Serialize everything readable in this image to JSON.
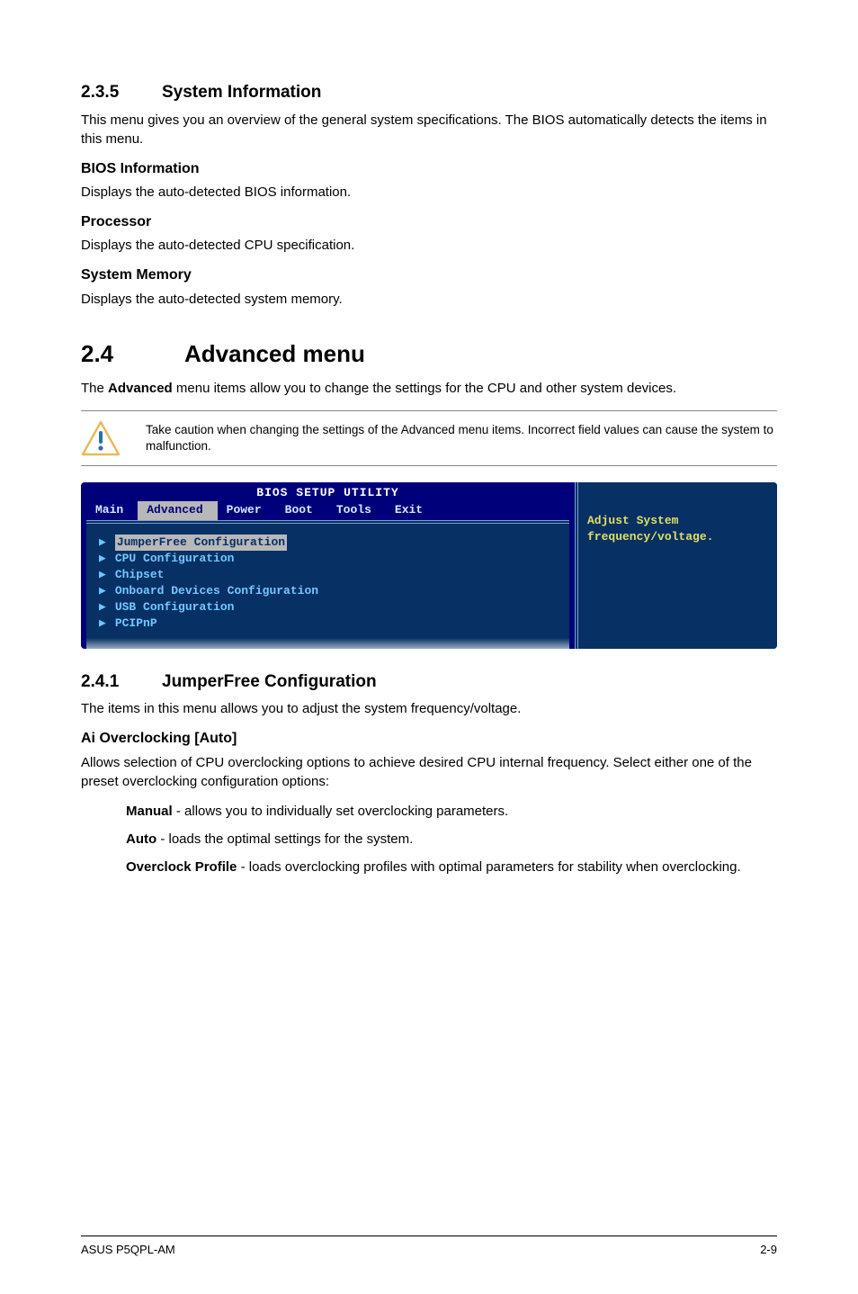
{
  "sec235": {
    "heading_num": "2.3.5",
    "heading_text": "System Information",
    "intro": "This menu gives you an overview of the general system specifications. The BIOS automatically detects the items in this menu.",
    "bios_info_h": "BIOS Information",
    "bios_info_p": "Displays the auto-detected BIOS information.",
    "proc_h": "Processor",
    "proc_p": "Displays the auto-detected CPU specification.",
    "mem_h": "System Memory",
    "mem_p": "Displays the auto-detected system memory."
  },
  "sec24": {
    "heading_num": "2.4",
    "heading_text": "Advanced menu",
    "intro_pre": "The ",
    "intro_bold": "Advanced",
    "intro_post": " menu items allow you to change the settings for the CPU and other system devices.",
    "caution": "Take caution when changing the settings of the Advanced menu items. Incorrect field values can cause the system to malfunction."
  },
  "bios": {
    "title": "BIOS SETUP UTILITY",
    "tabs": [
      "Main",
      "Advanced",
      "Power",
      "Boot",
      "Tools",
      "Exit"
    ],
    "selected_tab_index": 1,
    "items": [
      "JumperFree Configuration",
      "CPU Configuration",
      "Chipset",
      "Onboard Devices Configuration",
      "USB Configuration",
      "PCIPnP"
    ],
    "selected_item_index": 0,
    "help_line1": "Adjust System",
    "help_line2": "frequency/voltage."
  },
  "sec241": {
    "heading_num": "2.4.1",
    "heading_text": "JumperFree Configuration",
    "intro": "The items in this menu allows you to adjust the system frequency/voltage.",
    "ai_h": "Ai Overclocking [Auto]",
    "ai_p": "Allows selection of CPU overclocking options to achieve desired CPU internal frequency. Select either one of the preset overclocking configuration options:",
    "opt1_b": "Manual",
    "opt1_t": " - allows you to individually set overclocking parameters.",
    "opt2_b": "Auto",
    "opt2_t": " - loads the optimal settings for the system.",
    "opt3_b": "Overclock Profile",
    "opt3_t": " - loads overclocking profiles with optimal parameters for stability when overclocking."
  },
  "footer": {
    "left": "ASUS P5QPL-AM",
    "right": "2-9"
  }
}
